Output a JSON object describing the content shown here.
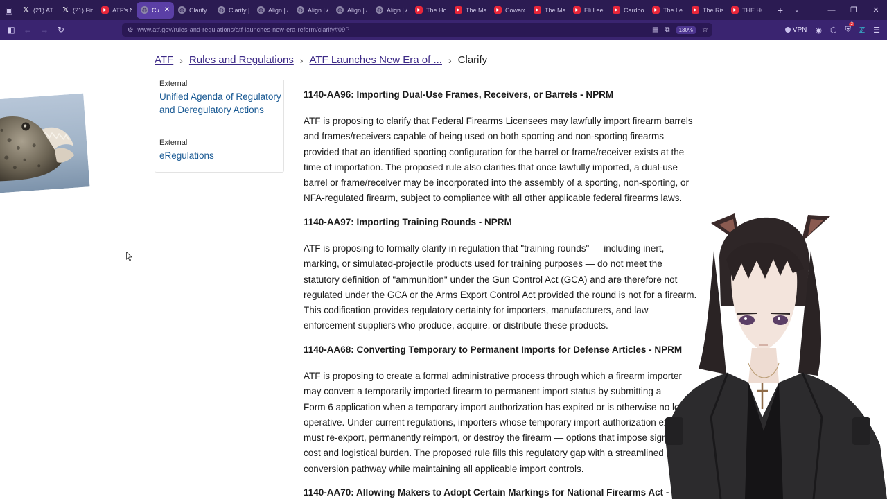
{
  "browser": {
    "tabs": [
      {
        "favicon": "x-icon",
        "title": "(21) AT"
      },
      {
        "favicon": "x-icon",
        "title": "(21) Fir"
      },
      {
        "favicon": "youtube-icon",
        "title": "ATF's N"
      },
      {
        "favicon": "globe-icon",
        "title": "Clari",
        "active": true
      },
      {
        "favicon": "globe-icon",
        "title": "Clarify |"
      },
      {
        "favicon": "globe-icon",
        "title": "Clarify |"
      },
      {
        "favicon": "globe-icon",
        "title": "Align | A"
      },
      {
        "favicon": "globe-icon",
        "title": "Align | A"
      },
      {
        "favicon": "globe-icon",
        "title": "Align | A"
      },
      {
        "favicon": "globe-icon",
        "title": "Align | A"
      },
      {
        "favicon": "youtube-icon",
        "title": "The Ho"
      },
      {
        "favicon": "youtube-icon",
        "title": "The Ma"
      },
      {
        "favicon": "youtube-icon",
        "title": "Coward"
      },
      {
        "favicon": "youtube-icon",
        "title": "The Ma"
      },
      {
        "favicon": "youtube-icon",
        "title": "Eli Lee"
      },
      {
        "favicon": "youtube-icon",
        "title": "Cardbo"
      },
      {
        "favicon": "youtube-icon",
        "title": "The Lef"
      },
      {
        "favicon": "youtube-icon",
        "title": "The Ris"
      },
      {
        "favicon": "youtube-icon",
        "title": "THE HC"
      }
    ],
    "url": "www.atf.gov/rules-and-regulations/atf-launches-new-era-reform/clarify#09P",
    "zoom": "130%",
    "vpn_label": "VPN",
    "extension_badge": "2"
  },
  "breadcrumb": {
    "home": "ATF",
    "section": "Rules and Regulations",
    "parent": "ATF Launches New Era of ...",
    "current": "Clarify",
    "separator": "›"
  },
  "related": [
    {
      "kind": "External",
      "label": "Unified Agenda of Regulatory and Deregulatory Actions"
    },
    {
      "kind": "External",
      "label": "eRegulations"
    }
  ],
  "items": [
    {
      "title": "1140-AA96: Importing Dual-Use Frames, Receivers, or Barrels - NPRM",
      "body": "ATF is proposing to clarify that Federal Firearms Licensees may lawfully import firearm barrels\nand frames/receivers capable of being used on both sporting and non-sporting firearms\nprovided that an identified sporting configuration for the barrel or frame/receiver exists at the\ntime of importation. The proposed rule also clarifies that once lawfully imported, a dual-use\nbarrel or frame/receiver may be incorporated into the assembly of a sporting, non-sporting, or\nNFA-regulated firearm, subject to compliance with all other applicable federal firearms laws."
    },
    {
      "title": "1140-AA97: Importing Training Rounds - NPRM",
      "body": "ATF is proposing to formally clarify in regulation that \"training rounds\" — including inert,\nmarking, or simulated-projectile products used for training purposes — do not meet the\nstatutory definition of \"ammunition\" under the Gun Control Act (GCA) and are therefore not\nregulated under the GCA or the Arms Export Control Act provided the round is not for a firearm.\nThis codification provides regulatory certainty for importers, manufacturers, and law\nenforcement suppliers who produce, acquire, or distribute these products."
    },
    {
      "title": "1140-AA68: Converting Temporary to Permanent Imports for Defense Articles - NPRM",
      "body": "ATF is proposing to create a formal administrative process through which a firearm importer\nmay convert a temporarily imported firearm to permanent import status by submitting a\nForm 6 application when a temporary import authorization has expired or is otherwise no longer\noperative. Under current regulations, importers whose temporary import authorization expires\nmust re-export, permanently reimport, or destroy the firearm — options that impose significant\ncost and logistical burden. The proposed rule fills this regulatory gap with a streamlined\nconversion pathway while maintaining all applicable import controls."
    },
    {
      "title": "1140-AA70: Allowing Makers to Adopt Certain Markings for National Firearms Act -",
      "body": ""
    }
  ]
}
